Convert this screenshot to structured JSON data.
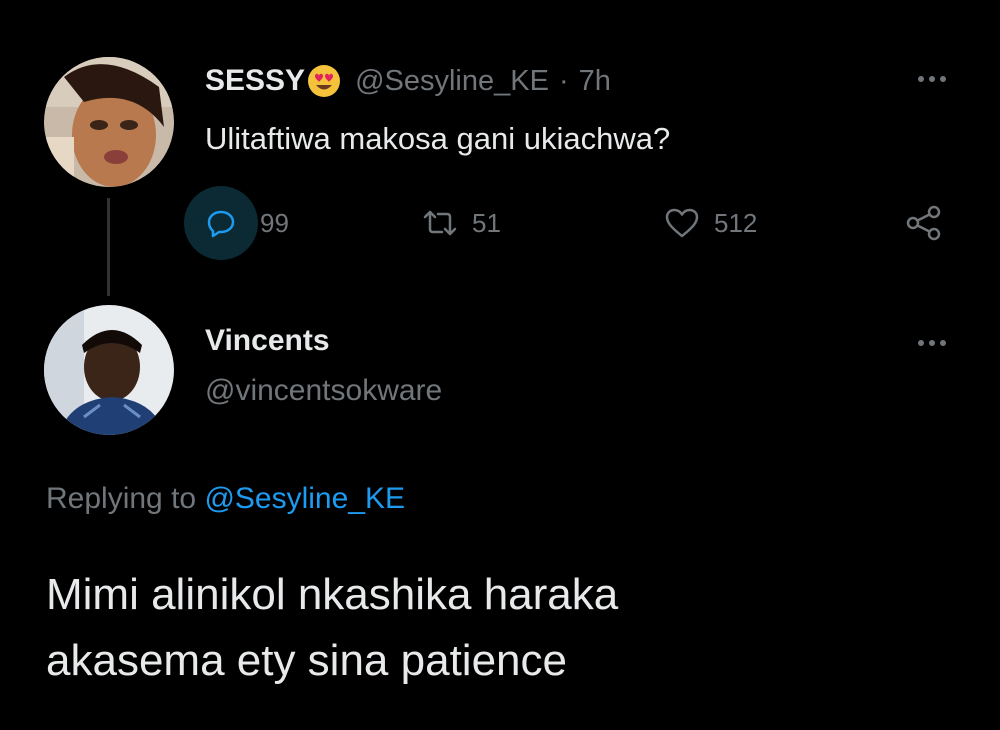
{
  "tweet": {
    "display_name": "SESSY",
    "emoji": "heart-eyes-emoji",
    "handle": "@Sesyline_KE",
    "separator": "·",
    "time": "7h",
    "text": "Ulitaftiwa makosa gani ukiachwa?",
    "actions": {
      "reply_count": "99",
      "retweet_count": "51",
      "like_count": "512"
    }
  },
  "reply": {
    "display_name": "Vincents",
    "handle": "@vincentsokware",
    "replying_prefix": "Replying to",
    "replying_mention": "@Sesyline_KE",
    "text_lines": [
      "Mimi alinikol nkashika haraka",
      "akasema ety sina patience"
    ]
  },
  "colors": {
    "background": "#000000",
    "primary_text": "#e7e9ea",
    "secondary_text": "#71767b",
    "link": "#1d9bf0",
    "reply_highlight": "#0b2a33"
  },
  "icons": [
    "more-icon",
    "reply-icon",
    "retweet-icon",
    "like-icon",
    "share-icon",
    "heart-eyes-emoji"
  ]
}
